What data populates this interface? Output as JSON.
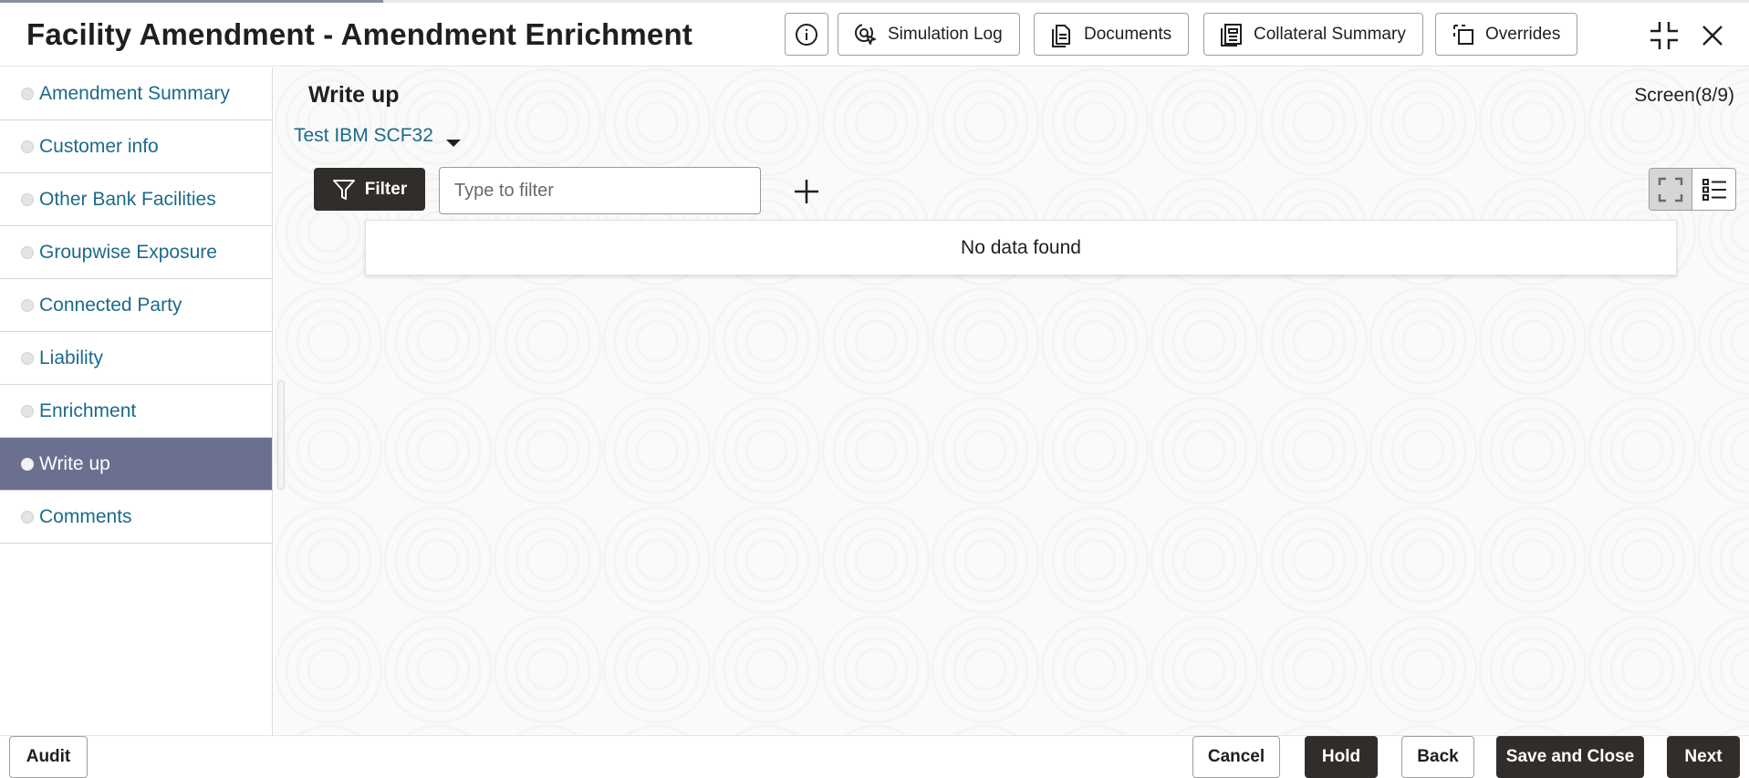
{
  "header": {
    "title": "Facility Amendment - Amendment Enrichment",
    "buttons": {
      "simulation_log": "Simulation Log",
      "documents": "Documents",
      "collateral_summary": "Collateral Summary",
      "overrides": "Overrides"
    },
    "icons": [
      "info-icon",
      "simulation-log-icon",
      "documents-icon",
      "collateral-summary-icon",
      "overrides-icon",
      "collapse-icon",
      "close-icon"
    ]
  },
  "sidebar": {
    "items": [
      {
        "label": "Amendment Summary"
      },
      {
        "label": "Customer info"
      },
      {
        "label": "Other Bank Facilities"
      },
      {
        "label": "Groupwise Exposure"
      },
      {
        "label": "Connected Party"
      },
      {
        "label": "Liability"
      },
      {
        "label": "Enrichment"
      },
      {
        "label": "Write up"
      },
      {
        "label": "Comments"
      }
    ],
    "active_item": "Write up"
  },
  "main": {
    "section_title": "Write up",
    "screen_counter": "Screen(8/9)",
    "party_select": "Test IBM SCF32",
    "filter_button": "Filter",
    "filter_placeholder": "Type to filter",
    "empty_message": "No data found"
  },
  "footer": {
    "audit": "Audit",
    "cancel": "Cancel",
    "hold": "Hold",
    "back": "Back",
    "save_and_close": "Save and Close",
    "next": "Next"
  },
  "colors": {
    "primary_dark": "#312d2a",
    "link": "#1c6a8a",
    "active_nav": "#6b7090"
  }
}
